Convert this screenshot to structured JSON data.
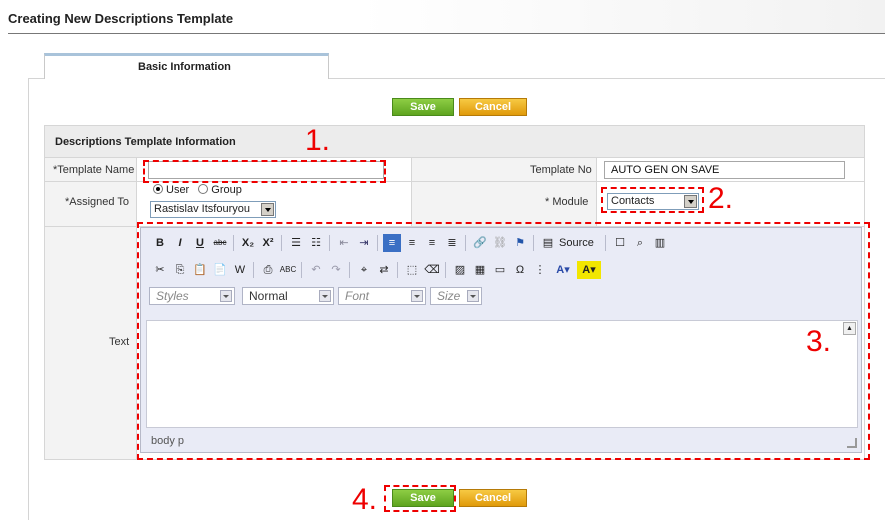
{
  "page": {
    "title": "Creating New Descriptions Template"
  },
  "tabs": [
    {
      "label": "Basic Information",
      "active": true
    }
  ],
  "actions": {
    "save_label": "Save",
    "cancel_label": "Cancel"
  },
  "section": {
    "header": "Descriptions Template Information"
  },
  "fields": {
    "template_name": {
      "label": "*Template Name",
      "value": ""
    },
    "template_no": {
      "label": "Template No",
      "value": "AUTO GEN ON SAVE"
    },
    "assigned_to": {
      "label": "*Assigned To",
      "radio_user": "User",
      "radio_group": "Group",
      "selected_radio": "User",
      "value": "Rastislav Itsfouryou"
    },
    "module": {
      "label": "* Module",
      "value": "Contacts"
    },
    "text": {
      "label": "Text"
    }
  },
  "editor": {
    "row1": [
      "B",
      "I",
      "U",
      "abc",
      "X₂",
      "X²",
      "ordered-list-icon",
      "unordered-list-icon",
      "outdent-icon",
      "indent-icon",
      "align-left-icon",
      "align-center-icon",
      "align-right-icon",
      "justify-icon",
      "link-icon",
      "unlink-icon",
      "anchor-icon"
    ],
    "source_label": "Source",
    "combos": {
      "styles": "Styles",
      "format": "Normal",
      "font": "Font",
      "size": "Size"
    },
    "status_path": "body  p"
  },
  "annotations": [
    "1.",
    "2.",
    "3.",
    "4."
  ],
  "colors": {
    "annotation": "#ee0000",
    "save": "#6db32a",
    "cancel": "#f0b323",
    "tab_accent": "#a9c3da"
  }
}
